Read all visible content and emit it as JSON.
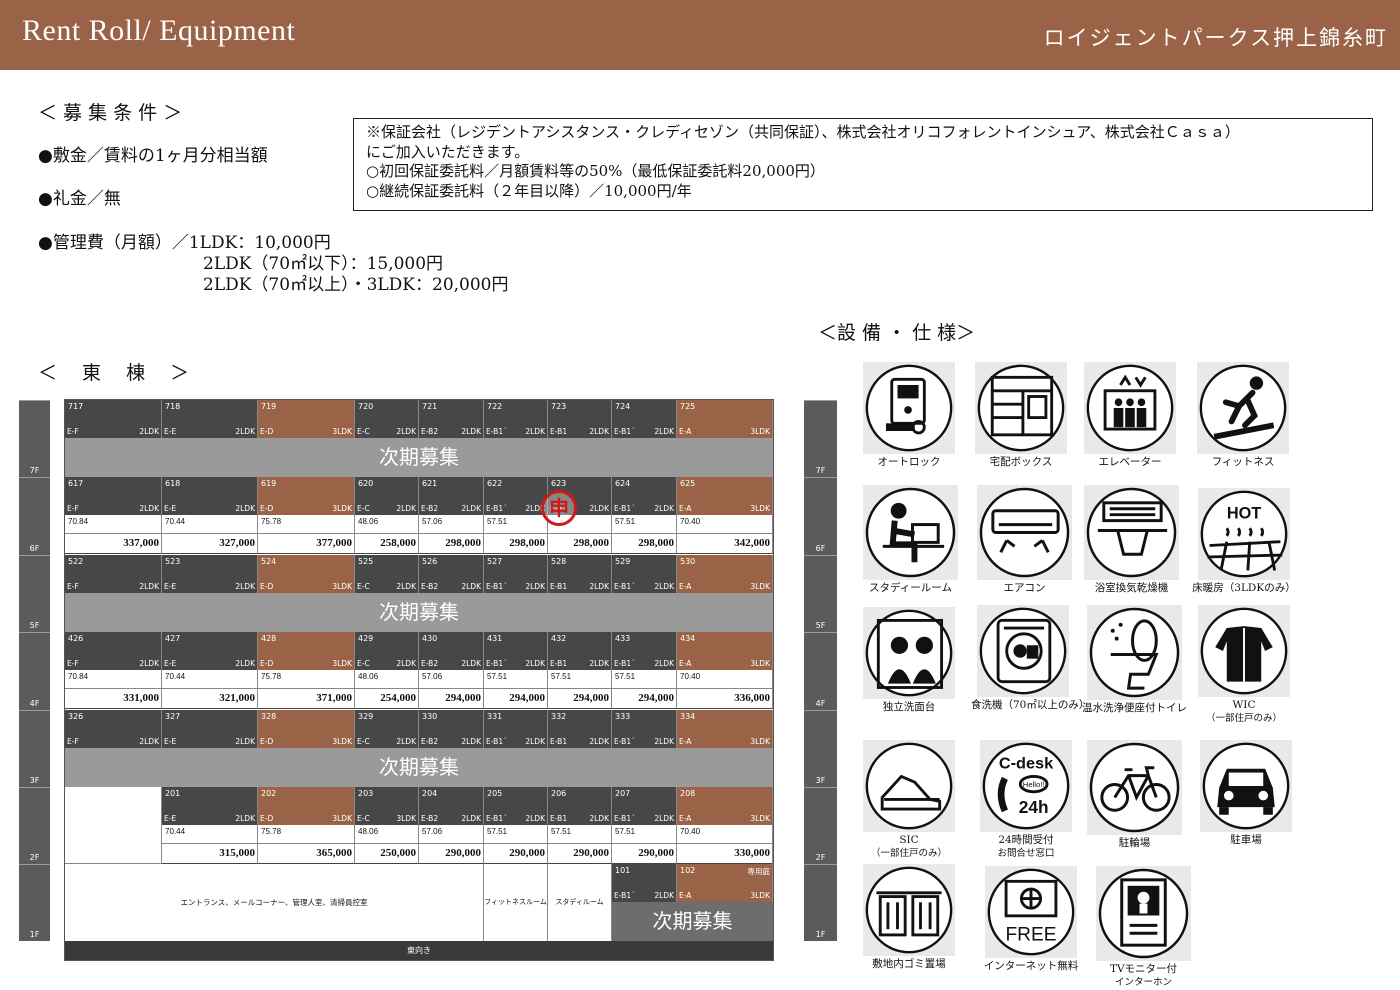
{
  "header": {
    "title": "Rent Roll/ Equipment",
    "building": "ロイジェントパークス押上錦糸町"
  },
  "conditions": {
    "title": "＜ 募 集 条 件 ＞",
    "deposit": "●敷金／賃料の1ヶ月分相当額",
    "key_money": "●礼金／無",
    "mgmt_line1": "●管理費（月額）／1LDK：10,000円",
    "mgmt_line2": "2LDK（70㎡以下）：15,000円",
    "mgmt_line3": "2LDK（70㎡以上）・3LDK：20,000円"
  },
  "guarantee_note": {
    "line1": "※保証会社（レジデントアシスタンス・クレディセゾン（共同保証）、株式会社オリコフォレントインシュア、株式会社Ｃａｓａ）",
    "line2": "にご加入いただきます。",
    "line3": "○初回保証委託料／月額賃料等の50%（最低保証委託料20,000円）",
    "line4": "○継続保証委託料（２年目以降）／10,000円/年"
  },
  "plan": {
    "title": "＜　 東　 棟　 ＞",
    "floor_labels": [
      "7F",
      "6F",
      "5F",
      "4F",
      "3F",
      "2F",
      "1F"
    ],
    "next_recruit": "次期募集",
    "floors": [
      {
        "units": [
          {
            "no": "717",
            "type": "E-F",
            "layout": "2LDK",
            "color": "dark"
          },
          {
            "no": "718",
            "type": "E-E",
            "layout": "2LDK",
            "color": "dark"
          },
          {
            "no": "719",
            "type": "E-D",
            "layout": "3LDK",
            "color": "brown"
          },
          {
            "no": "720",
            "type": "E-C",
            "layout": "2LDK",
            "color": "dark"
          },
          {
            "no": "721",
            "type": "E-B2",
            "layout": "2LDK",
            "color": "dark"
          },
          {
            "no": "722",
            "type": "E-B1´",
            "layout": "2LDK",
            "color": "dark"
          },
          {
            "no": "723",
            "type": "E-B1",
            "layout": "2LDK",
            "color": "dark"
          },
          {
            "no": "724",
            "type": "E-B1´",
            "layout": "2LDK",
            "color": "dark"
          },
          {
            "no": "725",
            "type": "E-A",
            "layout": "3LDK",
            "color": "brown"
          }
        ]
      },
      {
        "units": [
          {
            "no": "617",
            "type": "E-F",
            "layout": "2LDK",
            "color": "dark",
            "area": "70.84",
            "rent": "337,000"
          },
          {
            "no": "618",
            "type": "E-E",
            "layout": "2LDK",
            "color": "dark",
            "area": "70.44",
            "rent": "327,000"
          },
          {
            "no": "619",
            "type": "E-D",
            "layout": "3LDK",
            "color": "brown",
            "area": "75.78",
            "rent": "377,000"
          },
          {
            "no": "620",
            "type": "E-C",
            "layout": "2LDK",
            "color": "dark",
            "area": "48.06",
            "rent": "258,000"
          },
          {
            "no": "621",
            "type": "E-B2",
            "layout": "2LDK",
            "color": "dark",
            "area": "57.06",
            "rent": "298,000"
          },
          {
            "no": "622",
            "type": "E-B1´",
            "layout": "2LDK",
            "color": "dark",
            "area": "57.51",
            "rent": "298,000"
          },
          {
            "no": "623",
            "type": "E-B1",
            "layout": "2LDK",
            "color": "dark",
            "area": "",
            "rent": "298,000"
          },
          {
            "no": "624",
            "type": "E-B1´",
            "layout": "2LDK",
            "color": "dark",
            "area": "57.51",
            "rent": "298,000"
          },
          {
            "no": "625",
            "type": "E-A",
            "layout": "3LDK",
            "color": "brown",
            "area": "70.40",
            "rent": "342,000"
          }
        ]
      },
      {
        "units": [
          {
            "no": "522",
            "type": "E-F",
            "layout": "2LDK",
            "color": "dark"
          },
          {
            "no": "523",
            "type": "E-E",
            "layout": "2LDK",
            "color": "dark"
          },
          {
            "no": "524",
            "type": "E-D",
            "layout": "3LDK",
            "color": "brown"
          },
          {
            "no": "525",
            "type": "E-C",
            "layout": "2LDK",
            "color": "dark"
          },
          {
            "no": "526",
            "type": "E-B2",
            "layout": "2LDK",
            "color": "dark"
          },
          {
            "no": "527",
            "type": "E-B1´",
            "layout": "2LDK",
            "color": "dark"
          },
          {
            "no": "528",
            "type": "E-B1",
            "layout": "2LDK",
            "color": "dark"
          },
          {
            "no": "529",
            "type": "E-B1´",
            "layout": "2LDK",
            "color": "dark"
          },
          {
            "no": "530",
            "type": "E-A",
            "layout": "3LDK",
            "color": "brown"
          }
        ]
      },
      {
        "units": [
          {
            "no": "426",
            "type": "E-F",
            "layout": "2LDK",
            "color": "dark",
            "area": "70.84",
            "rent": "331,000"
          },
          {
            "no": "427",
            "type": "E-E",
            "layout": "2LDK",
            "color": "dark",
            "area": "70.44",
            "rent": "321,000"
          },
          {
            "no": "428",
            "type": "E-D",
            "layout": "3LDK",
            "color": "brown",
            "area": "75.78",
            "rent": "371,000"
          },
          {
            "no": "429",
            "type": "E-C",
            "layout": "2LDK",
            "color": "dark",
            "area": "48.06",
            "rent": "254,000"
          },
          {
            "no": "430",
            "type": "E-B2",
            "layout": "2LDK",
            "color": "dark",
            "area": "57.06",
            "rent": "294,000"
          },
          {
            "no": "431",
            "type": "E-B1´",
            "layout": "2LDK",
            "color": "dark",
            "area": "57.51",
            "rent": "294,000"
          },
          {
            "no": "432",
            "type": "E-B1",
            "layout": "2LDK",
            "color": "dark",
            "area": "57.51",
            "rent": "294,000"
          },
          {
            "no": "433",
            "type": "E-B1´",
            "layout": "2LDK",
            "color": "dark",
            "area": "57.51",
            "rent": "294,000"
          },
          {
            "no": "434",
            "type": "E-A",
            "layout": "3LDK",
            "color": "brown",
            "area": "70.40",
            "rent": "336,000"
          }
        ]
      },
      {
        "units": [
          {
            "no": "326",
            "type": "E-F",
            "layout": "2LDK",
            "color": "dark"
          },
          {
            "no": "327",
            "type": "E-E",
            "layout": "2LDK",
            "color": "dark"
          },
          {
            "no": "328",
            "type": "E-D",
            "layout": "3LDK",
            "color": "brown"
          },
          {
            "no": "329",
            "type": "E-C",
            "layout": "2LDK",
            "color": "dark"
          },
          {
            "no": "330",
            "type": "E-B2",
            "layout": "2LDK",
            "color": "dark"
          },
          {
            "no": "331",
            "type": "E-B1´",
            "layout": "2LDK",
            "color": "dark"
          },
          {
            "no": "332",
            "type": "E-B1",
            "layout": "2LDK",
            "color": "dark"
          },
          {
            "no": "333",
            "type": "E-B1´",
            "layout": "2LDK",
            "color": "dark"
          },
          {
            "no": "334",
            "type": "E-A",
            "layout": "3LDK",
            "color": "brown"
          }
        ]
      },
      {
        "units": [
          {
            "no": "201",
            "type": "E-E",
            "layout": "2LDK",
            "color": "dark",
            "area": "70.44",
            "rent": "315,000"
          },
          {
            "no": "202",
            "type": "E-D",
            "layout": "3LDK",
            "color": "brown",
            "area": "75.78",
            "rent": "365,000"
          },
          {
            "no": "203",
            "type": "E-C",
            "layout": "3LDK",
            "color": "dark",
            "area": "48.06",
            "rent": "250,000"
          },
          {
            "no": "204",
            "type": "E-B2",
            "layout": "2LDK",
            "color": "dark",
            "area": "57.06",
            "rent": "290,000"
          },
          {
            "no": "205",
            "type": "E-B1´",
            "layout": "2LDK",
            "color": "dark",
            "area": "57.51",
            "rent": "290,000"
          },
          {
            "no": "206",
            "type": "E-B1",
            "layout": "2LDK",
            "color": "dark",
            "area": "57.51",
            "rent": "290,000"
          },
          {
            "no": "207",
            "type": "E-B1´",
            "layout": "2LDK",
            "color": "dark",
            "area": "57.51",
            "rent": "290,000"
          },
          {
            "no": "208",
            "type": "E-A",
            "layout": "3LDK",
            "color": "brown",
            "area": "70.40",
            "rent": "330,000"
          }
        ]
      }
    ],
    "first_floor": {
      "entrance": "エントランス、メールコーナー、管理人室、清掃員控室",
      "fitness": "フィットネスルーム",
      "study": "スタディルーム",
      "u101": {
        "no": "101",
        "type": "E-B1´",
        "layout": "2LDK"
      },
      "u102": {
        "no": "102",
        "type": "E-A",
        "layout": "3LDK",
        "extra": "専用庭"
      },
      "bottom": "東向き"
    },
    "stamp": "申"
  },
  "equipment": {
    "title": "＜設 備 ・ 仕 様＞",
    "items": [
      {
        "label": "オートロック",
        "sub": "",
        "icon": "intercom-icon"
      },
      {
        "label": "宅配ボックス",
        "sub": "",
        "icon": "delivery-box-icon"
      },
      {
        "label": "エレベーター",
        "sub": "",
        "icon": "elevator-icon"
      },
      {
        "label": "フィットネス",
        "sub": "",
        "icon": "fitness-icon"
      },
      {
        "label": "スタディールーム",
        "sub": "",
        "icon": "study-room-icon"
      },
      {
        "label": "エアコン",
        "sub": "",
        "icon": "air-conditioner-icon"
      },
      {
        "label": "浴室換気乾燥機",
        "sub": "",
        "icon": "bath-dryer-icon"
      },
      {
        "label": "床暖房（3LDKのみ）",
        "sub": "",
        "icon": "floor-heating-icon",
        "hot": "HOT"
      },
      {
        "label": "独立洗面台",
        "sub": "",
        "icon": "vanity-icon"
      },
      {
        "label": "食洗機（70㎡以上のみ）",
        "sub": "",
        "icon": "dishwasher-icon"
      },
      {
        "label": "温水洗浄便座付トイレ",
        "sub": "",
        "icon": "toilet-icon"
      },
      {
        "label": "WIC",
        "sub": "（一部住戸のみ）",
        "icon": "walk-in-closet-icon"
      },
      {
        "label": "SIC",
        "sub": "（一部住戸のみ）",
        "icon": "shoe-closet-icon"
      },
      {
        "label": "24時間受付",
        "sub": "お問合せ窓口",
        "icon": "cdesk-icon",
        "t1": "C-desk",
        "t2": "Hello!!",
        "t3": "24h"
      },
      {
        "label": "駐輪場",
        "sub": "",
        "icon": "bicycle-icon"
      },
      {
        "label": "駐車場",
        "sub": "",
        "icon": "car-icon"
      },
      {
        "label": "敷地内ゴミ置場",
        "sub": "",
        "icon": "trash-icon"
      },
      {
        "label": "インターネット無料",
        "sub": "",
        "icon": "internet-icon",
        "t1": "FREE"
      },
      {
        "label": "TVモニター付",
        "sub": "インターホン",
        "icon": "tv-intercom-icon"
      }
    ]
  }
}
